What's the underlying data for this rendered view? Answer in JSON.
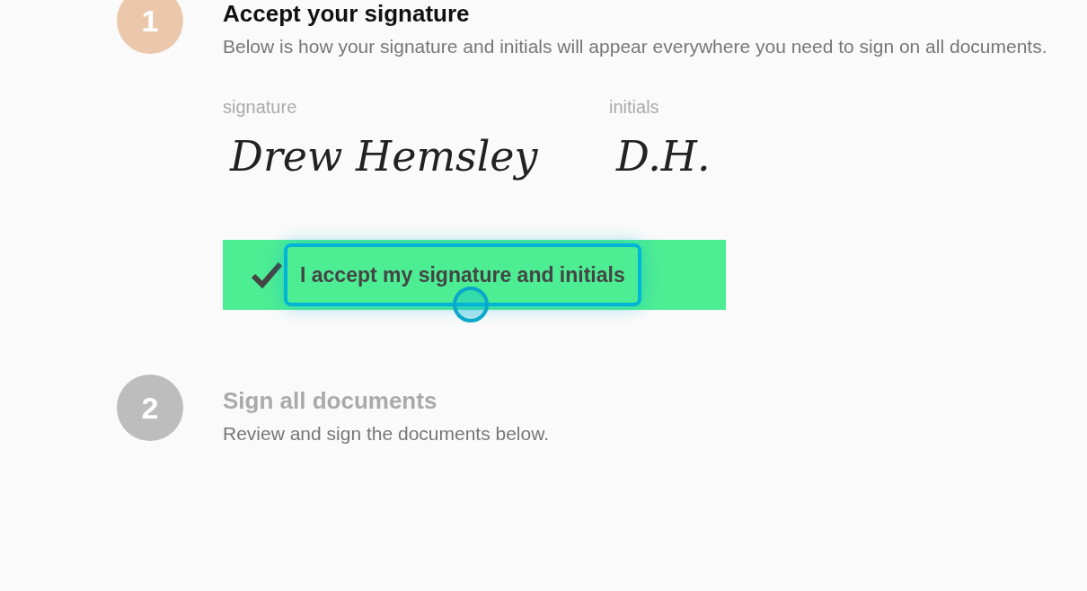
{
  "steps": [
    {
      "number": "1",
      "title": "Accept your signature",
      "description": "Below is how your signature and initials will appear everywhere you need to sign on all documents.",
      "active": true,
      "signature": {
        "signature_label": "signature",
        "signature_value": "Drew Hemsley",
        "initials_label": "initials",
        "initials_value": "D.H."
      },
      "accept": {
        "label": "I accept my signature and initials",
        "checked": true,
        "focused": true
      }
    },
    {
      "number": "2",
      "title": "Sign all documents",
      "description": "Review and sign the documents below.",
      "active": false
    }
  ]
}
